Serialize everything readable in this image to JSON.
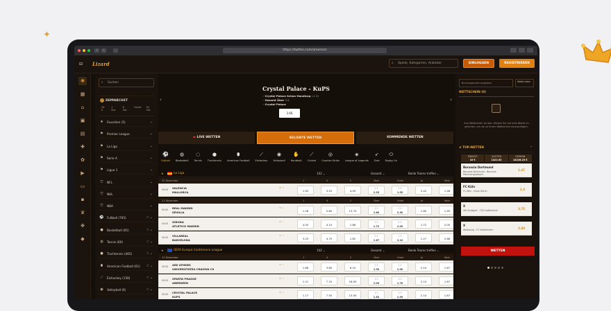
{
  "browser": {
    "url": "https://twitter.com/ameronn"
  },
  "header": {
    "logo": "Lizard",
    "search_placeholder": "Spiele, Kategorien, Anbieter",
    "login_label": "EINLOGGEN",
    "register_label": "REGISTRIEREN"
  },
  "sidebar": {
    "search_placeholder": "Suchen",
    "demnaechst": {
      "title": "DEMNÄCHST",
      "filters": [
        "24 h",
        "1 Std.",
        "6 Std.",
        "Heute",
        "90 Std."
      ]
    },
    "items": [
      {
        "label": "Favoriten (5)",
        "icon": "star-icon"
      },
      {
        "label": "Premier League",
        "icon": "flag-icon"
      },
      {
        "label": "La Liga",
        "icon": "flag-icon"
      },
      {
        "label": "Serie A",
        "icon": "flag-icon"
      },
      {
        "label": "Ligue 1",
        "icon": "flag-icon"
      },
      {
        "label": "NFL",
        "icon": "shield-icon"
      },
      {
        "label": "NHL",
        "icon": "shield-icon"
      },
      {
        "label": "NBA",
        "icon": "shield-icon"
      },
      {
        "label": "Fußball (765)",
        "icon": "soccer-icon"
      },
      {
        "label": "Basketball (65)",
        "icon": "basketball-icon"
      },
      {
        "label": "Tennis (60)",
        "icon": "tennis-icon"
      },
      {
        "label": "Tischtennis (465)",
        "icon": "table-tennis-icon"
      },
      {
        "label": "American Football (61)",
        "icon": "football-icon"
      },
      {
        "label": "Eishockey (158)",
        "icon": "hockey-icon"
      },
      {
        "label": "Volleyball (6)",
        "icon": "volleyball-icon"
      }
    ]
  },
  "banner": {
    "title": "Crystal Palace - KuPS",
    "lines": [
      {
        "b": "Crystal Palace Schon Handicap",
        "s": "(-1.5)"
      },
      {
        "b": "Gesamt Über",
        "s": "3.5"
      },
      {
        "b": "Crystal Palace",
        "s": ""
      }
    ],
    "odds": "3.66"
  },
  "tabs": {
    "live": "LIVE WETTEN",
    "beliebt": "BELIEBTE WETTEN",
    "kommend": "KOMMENDE WETTEN"
  },
  "sports": [
    "Fußball",
    "Basketball",
    "Tennis",
    "Tischtennis",
    "American Football",
    "Eishockey",
    "Volleyball",
    "Handball",
    "Cricket",
    "Counter-Strike",
    "League of Legends",
    "Dart",
    "Rugby Un"
  ],
  "leagues": [
    {
      "name": "La Liga",
      "sel1": "1X2",
      "sel2": "Gesamt",
      "sel3": "Beide Teams treffen"
    },
    {
      "name": "UEFA Europa Conference League",
      "sel1": "1X2",
      "sel2": "Gesamt",
      "sel3": "Beide Teams treffen"
    }
  ],
  "col_headers": [
    "1",
    "X",
    "2",
    "Über",
    "Unter",
    "Ja",
    "Nein"
  ],
  "dates": [
    "20 Dezember",
    "21 Dezember",
    "14 Dezember"
  ],
  "matches": [
    {
      "time": "00:00",
      "t1": "VALENCIA",
      "t2": "MALLORCA",
      "o1": "1.95",
      "ox": "3.25",
      "o2": "4.09",
      "line": "2.5",
      "ov": "2.35",
      "un": "1.55",
      "ja": "2.42",
      "nein": "1.48"
    },
    {
      "time": "00:00",
      "t1": "REAL MADRID",
      "t2": "SEVILLA",
      "o1": "1.28",
      "ox": "5.60",
      "o2": "13.75",
      "line": "2.5",
      "ov": "1.60",
      "un": "2.30",
      "ja": "1.80",
      "nein": "1.95"
    },
    {
      "time": "00:00",
      "t1": "GIRONA",
      "t2": "ATLETICO MADRID",
      "o1": "4.05",
      "ox": "4.10",
      "o2": "1.68",
      "line": "2.5",
      "ov": "1.72",
      "un": "2.05",
      "ja": "1.72",
      "nein": "2.05"
    },
    {
      "time": "00:00",
      "t1": "VILLAREAL",
      "t2": "BARCELONA",
      "o1": "3.25",
      "ox": "4.70",
      "o2": "1.82",
      "line": "2.5",
      "ov": "1.67",
      "un": "2.10",
      "ja": "1.27",
      "nein": "2.68"
    },
    {
      "time": "00:00",
      "t1": "AEK ATHENS",
      "t2": "UNIVERSITATEA CRAIOVA CS",
      "o1": "1.66",
      "ox": "3.80",
      "o2": "6.10",
      "line": "2.5",
      "ov": "1.90",
      "un": "1.90",
      "ja": "2.10",
      "nein": "1.67"
    },
    {
      "time": "00:00",
      "t1": "SPARTA PRAGUE",
      "t2": "ABERDEEN",
      "o1": "1.21",
      "ox": "7.25",
      "o2": "16.00",
      "line": "3.5",
      "ov": "2.05",
      "un": "1.76",
      "ja": "2.10",
      "nein": "1.67"
    },
    {
      "time": "00:00",
      "t1": "CRYSTAL PALACE",
      "t2": "KUPS",
      "o1": "1.17",
      "ox": "7.50",
      "o2": "13.00",
      "line": "3.5",
      "ov": "1.83",
      "un": "1.95",
      "ja": "2.10",
      "nein": "1.67"
    }
  ],
  "right": {
    "code_placeholder": "Buchungscode eingeben",
    "load_label": "Wette laden",
    "wettschein_label": "WETTSCHEIN (0)",
    "empty_text": "Ihre Wettschein ist leer. Klicken Sie auf eine Wette im gleichen, um sie zu Ihrem Wettschein hinzuzufügen.",
    "top_label": "TOP-WETTEN",
    "stats": [
      {
        "l": "EINSATZ",
        "v": "10 €"
      },
      {
        "l": "QUOTEN",
        "v": "1422.62"
      },
      {
        "l": "GEWINN",
        "v": "14226.25 €"
      }
    ],
    "picks": [
      {
        "a": "Borussia Dortmund",
        "b": "Borussia Dortmund - Borussia Mönchengladbach",
        "o": "1.47"
      },
      {
        "a": "FC Köln",
        "b": "FC Köln - Union Berlin",
        "o": "2.3"
      },
      {
        "a": "X",
        "b": "Vfb Stuttgart - TSG Hoffenheim",
        "o": "3.75"
      },
      {
        "a": "X",
        "b": "Wolfsburg - FC Heidenheim",
        "o": "3.40"
      }
    ],
    "wetten_label": "WETTEN"
  }
}
